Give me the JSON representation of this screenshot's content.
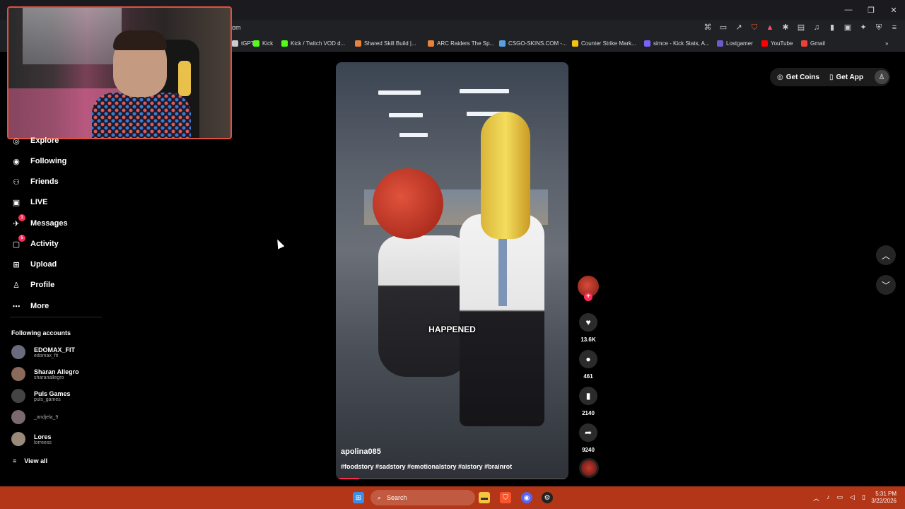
{
  "browser": {
    "url_fragment": "om",
    "bookmarks": [
      {
        "label": "tGPT",
        "icon": "chatgpt-icon",
        "color": "#cccccc"
      },
      {
        "label": "Kick",
        "icon": "kick-icon",
        "color": "#53fc18"
      },
      {
        "label": "Kick / Twitch VOD d...",
        "icon": "kick-icon",
        "color": "#53fc18"
      },
      {
        "label": "Shared Skill Build |...",
        "icon": "flame-icon",
        "color": "#e8833a"
      },
      {
        "label": "ARC Raiders The Sp...",
        "icon": "flame-icon",
        "color": "#e8833a"
      },
      {
        "label": "CSGO-SKINS.COM -...",
        "icon": "diamond-icon",
        "color": "#5aa0e0"
      },
      {
        "label": "Counter Strike Mark...",
        "icon": "cs-icon",
        "color": "#f1c40f"
      },
      {
        "label": "simce - Kick Stats, A...",
        "icon": "stats-icon",
        "color": "#7b61ff"
      },
      {
        "label": "Lostgamer",
        "icon": "lostgamer-icon",
        "color": "#6a5acd"
      },
      {
        "label": "YouTube",
        "icon": "youtube-icon",
        "color": "#ff0000"
      },
      {
        "label": "Gmail",
        "icon": "gmail-icon",
        "color": "#ea4335"
      }
    ]
  },
  "sidebar": {
    "items": [
      {
        "label": "Explore",
        "icon": "compass-icon"
      },
      {
        "label": "Following",
        "icon": "following-avatar-icon"
      },
      {
        "label": "Friends",
        "icon": "friends-icon"
      },
      {
        "label": "LIVE",
        "icon": "live-icon"
      },
      {
        "label": "Messages",
        "icon": "messages-icon",
        "badge": "1"
      },
      {
        "label": "Activity",
        "icon": "activity-icon",
        "badge": "5"
      },
      {
        "label": "Upload",
        "icon": "upload-icon"
      },
      {
        "label": "Profile",
        "icon": "profile-icon"
      },
      {
        "label": "More",
        "icon": "more-icon"
      }
    ],
    "following_title": "Following accounts",
    "accounts": [
      {
        "name": "EDOMAX_FIT",
        "handle": "edomax_fit"
      },
      {
        "name": "Sharan Allegro",
        "handle": "sharanallegro"
      },
      {
        "name": "Puls Games",
        "handle": "puls_games"
      },
      {
        "name": "",
        "handle": "_andjela_9"
      },
      {
        "name": "Lores",
        "handle": "lorreess"
      }
    ],
    "view_all": "View all"
  },
  "video": {
    "caption_overlay": "HAPPENED",
    "author": "apolina085",
    "hashtags": "#foodstory #sadstory #emotionalstory #aistory #brainrot",
    "progress": 0.1
  },
  "actions": {
    "likes": "13.6K",
    "comments": "461",
    "saves": "2140",
    "shares": "9240"
  },
  "header": {
    "get_coins": "Get Coins",
    "get_app": "Get App"
  },
  "taskbar": {
    "search_label": "Search",
    "time": "5:31 PM",
    "date": "3/22/2026"
  },
  "colors": {
    "accent": "#fe2c55",
    "taskbar": "#b23617",
    "webcam_border": "#e0513e"
  }
}
